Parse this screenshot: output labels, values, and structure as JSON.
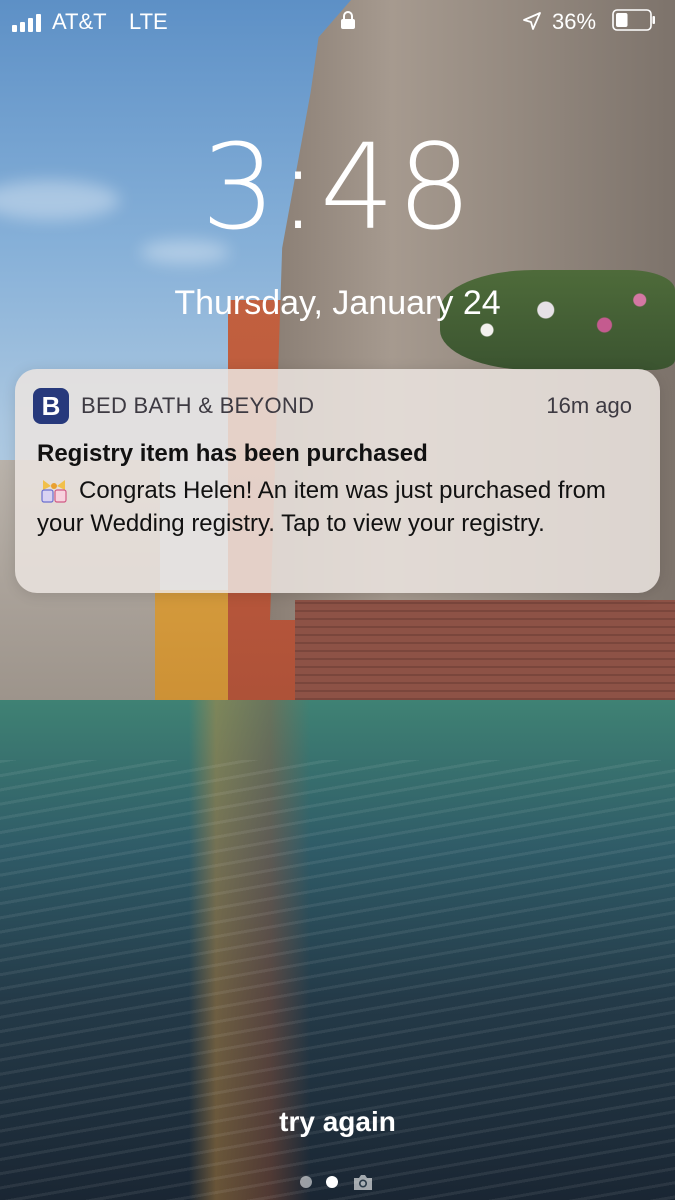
{
  "status_bar": {
    "carrier": "AT&T",
    "network": "LTE",
    "battery_percent": "36%",
    "signal_bars": 4,
    "battery_level": 0.36,
    "icons": [
      "signal-icon",
      "lock-icon",
      "location-arrow-icon",
      "battery-icon"
    ]
  },
  "lock_screen": {
    "time": "3:48",
    "date": "Thursday, January 24"
  },
  "notification": {
    "app_icon_letter": "B",
    "app_name": "BED BATH & BEYOND",
    "time_ago": "16m ago",
    "title": "Registry item has been purchased",
    "body": "Congrats Helen! An item was just purchased from your Wedding registry. Tap to view your registry.",
    "emoji": "wedding-gift-emoji-icon",
    "brand_color": "#27397c"
  },
  "bottom": {
    "hint": "try again",
    "page_dots": 2,
    "active_page": 2
  }
}
